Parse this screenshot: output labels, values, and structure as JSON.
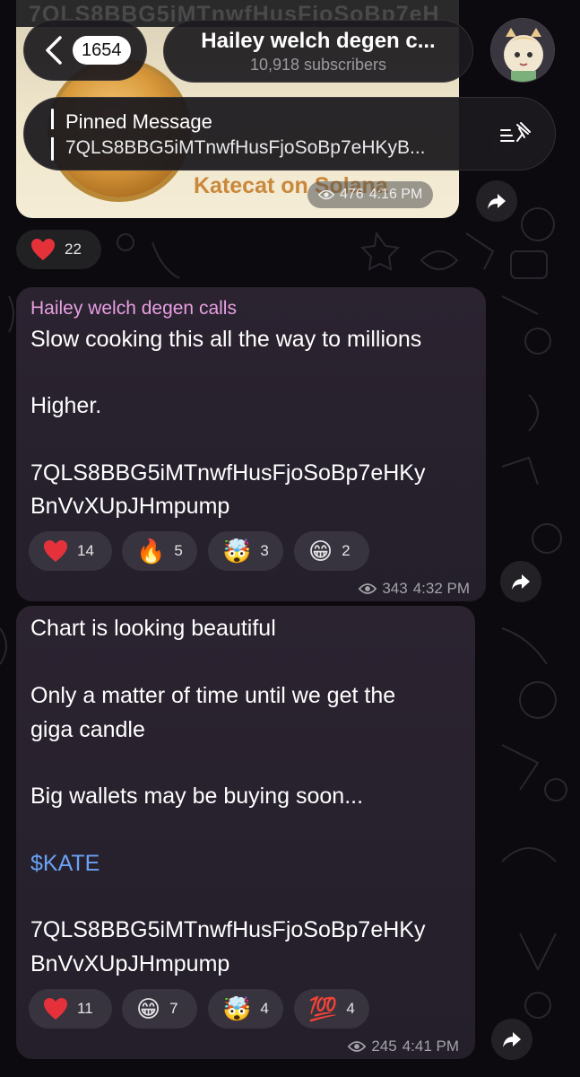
{
  "header": {
    "back_count": "1654",
    "channel_title": "Hailey welch degen c...",
    "subscribers": "10,918 subscribers"
  },
  "pinned": {
    "label": "Pinned Message",
    "text": "7QLS8BBG5iMTnwfHusFjoSoBp7eHKyB..."
  },
  "previous_message": {
    "image_top_text": "7QLS8BBG5iMTnwfHusFjoSoBp7eH",
    "image_caption": "Katecat on Solana",
    "views": "476",
    "time": "4:16 PM",
    "reactions": [
      {
        "emoji": "heart",
        "count": "22"
      }
    ]
  },
  "messages": [
    {
      "sender": "Hailey welch degen calls",
      "lines": [
        "Slow cooking this all the way to millions",
        "Higher.",
        "7QLS8BBG5iMTnwfHusFjoSoBp7eHKy",
        "BnVvXUpJHmpump"
      ],
      "reactions": [
        {
          "emoji": "heart",
          "count": "14"
        },
        {
          "emoji": "🔥",
          "count": "5"
        },
        {
          "emoji": "🤯",
          "count": "3"
        },
        {
          "emoji": "😁",
          "count": "2"
        }
      ],
      "views": "343",
      "time": "4:32 PM"
    },
    {
      "lines": [
        "Chart is looking beautiful",
        "Only a matter of time until we get the",
        "giga candle",
        "Big wallets may be buying soon...",
        "$KATE",
        "7QLS8BBG5iMTnwfHusFjoSoBp7eHKy",
        "BnVvXUpJHmpump"
      ],
      "reactions": [
        {
          "emoji": "heart",
          "count": "11"
        },
        {
          "emoji": "😁",
          "count": "7"
        },
        {
          "emoji": "🤯",
          "count": "4"
        },
        {
          "emoji": "💯",
          "count": "4"
        }
      ],
      "views": "245",
      "time": "4:41 PM"
    }
  ],
  "colors": {
    "background": "#0c0a0e",
    "bubble": "#2b2330",
    "sender_name": "#e79fe2",
    "link": "#6aa2f5",
    "heart": "#e5323a"
  },
  "icons": [
    "chevron-left-icon",
    "pin-list-icon",
    "eye-icon",
    "share-icon",
    "heart-icon"
  ]
}
